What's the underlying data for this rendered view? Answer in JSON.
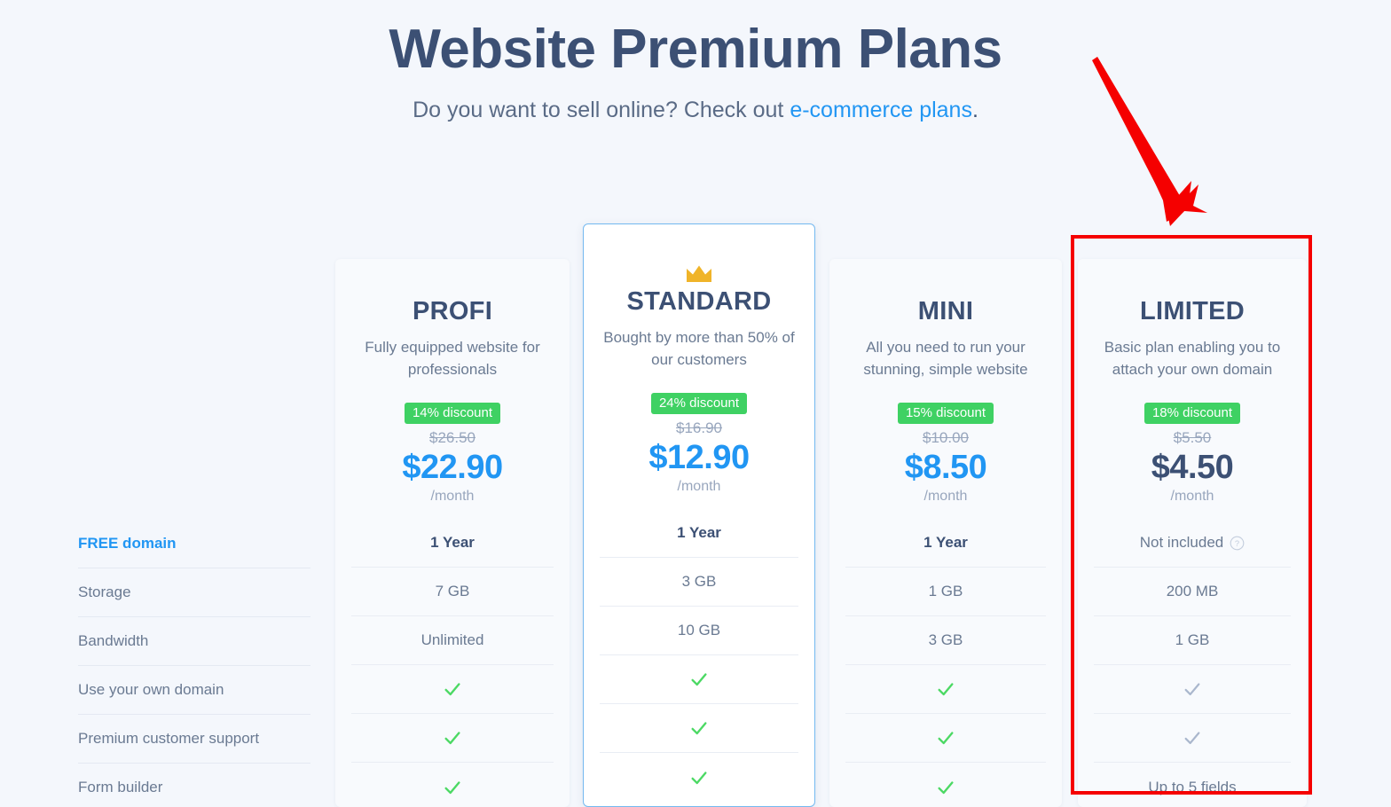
{
  "header": {
    "title": "Website Premium Plans",
    "subtitle_prefix": "Do you want to sell online? Check out ",
    "subtitle_link": "e-commerce plans",
    "subtitle_suffix": "."
  },
  "features": [
    {
      "label": "FREE domain"
    },
    {
      "label": "Storage"
    },
    {
      "label": "Bandwidth"
    },
    {
      "label": "Use your own domain"
    },
    {
      "label": "Premium customer support"
    },
    {
      "label": "Form builder"
    }
  ],
  "plans": [
    {
      "name": "PROFI",
      "description": "Fully equipped website for professionals",
      "discount": "14% discount",
      "old_price": "$26.50",
      "price": "$22.90",
      "period": "/month",
      "featured": false,
      "values": [
        "1 Year",
        "7 GB",
        "Unlimited",
        "check",
        "check",
        "check"
      ]
    },
    {
      "name": "STANDARD",
      "description": "Bought by more than 50% of our customers",
      "discount": "24% discount",
      "old_price": "$16.90",
      "price": "$12.90",
      "period": "/month",
      "featured": true,
      "crown_icon": "crown-icon",
      "values": [
        "1 Year",
        "3 GB",
        "10 GB",
        "check",
        "check",
        "check"
      ]
    },
    {
      "name": "MINI",
      "description": "All you need to run your stunning, simple website",
      "discount": "15% discount",
      "old_price": "$10.00",
      "price": "$8.50",
      "period": "/month",
      "featured": false,
      "values": [
        "1 Year",
        "1 GB",
        "3 GB",
        "check",
        "check",
        "check"
      ]
    },
    {
      "name": "LIMITED",
      "description": "Basic plan enabling you to attach your own domain",
      "discount": "18% discount",
      "old_price": "$5.50",
      "price": "$4.50",
      "period": "/month",
      "featured": false,
      "price_muted": true,
      "values": [
        "Not included",
        "200 MB",
        "1 GB",
        "check-disabled",
        "check-disabled",
        "Up to 5 fields"
      ],
      "help_icon_on_row": 0,
      "help_icon": "help-circle-icon"
    }
  ],
  "annotation": {
    "arrow_icon": "red-arrow-icon",
    "highlight_icon": "red-highlight-box",
    "color": "#f50000",
    "target_plan": "LIMITED"
  },
  "colors": {
    "background": "#f4f7fc",
    "title": "#3c5074",
    "accent_blue": "#2196f3",
    "badge_green": "#3fd163",
    "check_green": "#4cd964",
    "check_disabled": "#aab7cd",
    "crown_gold": "#f0b429",
    "annotation_red": "#f50000"
  }
}
